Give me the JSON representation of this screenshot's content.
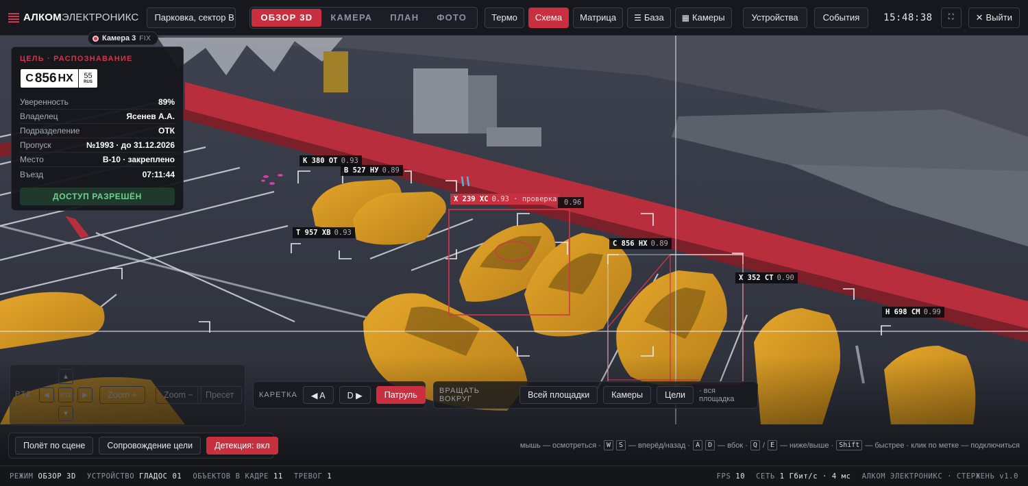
{
  "brand": {
    "bold": "АЛКОМ",
    "rest": "ЭЛЕКТРОНИКС"
  },
  "site_select": "Парковка, сектор В",
  "modes": [
    {
      "label": "ОБЗОР 3D",
      "active": true
    },
    {
      "label": "КАМЕРА",
      "active": false
    },
    {
      "label": "ПЛАН",
      "active": false
    },
    {
      "label": "ФОТО",
      "active": false
    }
  ],
  "toolbar": {
    "termo": "Термо",
    "schema": "Схема",
    "matrix": "Матрица",
    "base": "База",
    "cameras": "Камеры",
    "devices": "Устройства",
    "events": "События"
  },
  "clock": "15:48:38",
  "exit_label": "Выйти",
  "camera_chip": {
    "name": "Камера 3",
    "mode": "FIX"
  },
  "target": {
    "title": "ЦЕЛЬ · РАСПОЗНАВАНИЕ",
    "plate": {
      "letter1": "С",
      "number": "856",
      "letters2": "НХ",
      "region": "55",
      "country": "RUS"
    },
    "rows": [
      {
        "k": "Уверенность",
        "v": "89%"
      },
      {
        "k": "Владелец",
        "v": "Ясенев А.А."
      },
      {
        "k": "Подразделение",
        "v": "ОТК"
      },
      {
        "k": "Пропуск",
        "v": "№1993 · до 31.12.2026"
      },
      {
        "k": "Место",
        "v": "В-10 · закреплено"
      },
      {
        "k": "Въезд",
        "v": "07:11:44"
      }
    ],
    "access": "ДОСТУП РАЗРЕШЁН"
  },
  "detections": [
    {
      "plate": "К 380 ОТ",
      "conf": "0.93",
      "highlight": false
    },
    {
      "plate": "В 527 НУ",
      "conf": "0.89",
      "highlight": false
    },
    {
      "plate": "Х 239 ХС",
      "conf": "0.93 · проверка",
      "highlight": true
    },
    {
      "plate": "",
      "conf": "0.96",
      "highlight": false
    },
    {
      "plate": "Т 957 ХВ",
      "conf": "0.93",
      "highlight": false
    },
    {
      "plate": "С 856 НХ",
      "conf": "0.89",
      "highlight": false
    },
    {
      "plate": "Х 352 СТ",
      "conf": "0.90",
      "highlight": false
    },
    {
      "plate": "Н 698 СМ",
      "conf": "0.99",
      "highlight": false
    }
  ],
  "ptz": {
    "label": "PTZ",
    "center": "PTZ",
    "zoom_in": "Zoom +",
    "zoom_out": "Zoom −",
    "preset": "Пресет"
  },
  "carriage": {
    "label": "КАРЕТКА",
    "left": "◀ A",
    "right": "D ▶",
    "patrol": "Патруль"
  },
  "orbit": {
    "label": "ВРАЩАТЬ ВОКРУГ",
    "whole": "Всей площадки",
    "cams": "Камеры",
    "targets": "Цели",
    "note": "· вся площадка"
  },
  "scene_btns": {
    "fly": "Полёт по сцене",
    "track": "Сопровождение цели",
    "detect": "Детекция: вкл"
  },
  "hints": {
    "mouse": "мышь — осмотреться ·",
    "k_w": "W",
    "k_s": "S",
    "fb": "— вперёд/назад ·",
    "k_a": "A",
    "k_d": "D",
    "side": "— вбок ·",
    "k_q": "Q",
    "slash": "/",
    "k_e": "E",
    "ud": "— ниже/выше ·",
    "k_shift": "Shift",
    "fast": "— быстрее · клик по метке — подключиться"
  },
  "status": {
    "mode_k": "РЕЖИМ",
    "mode_v": "ОБЗОР 3D",
    "dev_k": "УСТРОЙСТВО",
    "dev_v": "ГЛАДОС 01",
    "obj_k": "ОБЪЕКТОВ В КАДРЕ",
    "obj_v": "11",
    "alarm_k": "ТРЕВОГ",
    "alarm_v": "1",
    "fps_k": "FPS",
    "fps_v": "10",
    "net_k": "СЕТЬ",
    "net_v": "1 Гбит/с · 4 мс",
    "core": "АЛКОМ ЭЛЕКТРОНИКС · СТЕРЖЕНЬ v1.0"
  },
  "colors": {
    "accent": "#c8303f",
    "car": "#d99a1f",
    "ok": "#6fd38e"
  }
}
